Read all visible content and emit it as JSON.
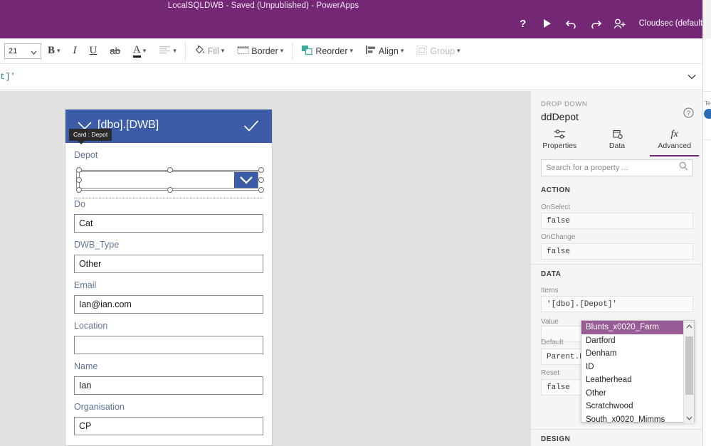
{
  "topbar": {
    "title": "LocalSQLDWB - Saved (Unpublished) - PowerApps",
    "help_icon": "help-icon",
    "play_icon": "play-icon",
    "undo_icon": "undo-icon",
    "redo_icon": "redo-icon",
    "share_icon": "add-user-icon",
    "user": "Cloudsec (default)"
  },
  "toolbar": {
    "font_size": "21",
    "bold": "B",
    "italic": "I",
    "underline": "U",
    "strikethrough": "ab",
    "font_color": "A",
    "align": "",
    "fill": "Fill",
    "border": "Border",
    "reorder": "Reorder",
    "align_label": "Align",
    "group": "Group"
  },
  "formula_bar": {
    "value": "t]'"
  },
  "canvas": {
    "form_header_title": "[dbo].[DWB]",
    "tooltip": "Card : Depot",
    "fields": [
      {
        "label": "Depot",
        "value": "",
        "type": "dropdown"
      },
      {
        "label": "Do",
        "value": "Cat",
        "type": "text"
      },
      {
        "label": "DWB_Type",
        "value": "Other",
        "type": "text"
      },
      {
        "label": "Email",
        "value": "Ian@ian.com",
        "type": "text"
      },
      {
        "label": "Location",
        "value": "",
        "type": "text"
      },
      {
        "label": "Name",
        "value": "Ian",
        "type": "text"
      },
      {
        "label": "Organisation",
        "value": "CP",
        "type": "text"
      }
    ]
  },
  "properties_panel": {
    "kicker": "DROP DOWN",
    "control_name": "ddDepot",
    "tabs": [
      {
        "label": "Properties",
        "icon": "sliders-icon",
        "active": false
      },
      {
        "label": "Data",
        "icon": "database-icon",
        "active": false
      },
      {
        "label": "Advanced",
        "icon": "fx-icon",
        "active": true
      }
    ],
    "search_placeholder": "Search for a property ...",
    "sections": [
      {
        "title": "ACTION",
        "props": [
          {
            "label": "OnSelect",
            "value": "false"
          },
          {
            "label": "OnChange",
            "value": "false"
          }
        ]
      },
      {
        "title": "DATA",
        "props": [
          {
            "label": "Items",
            "value": "'[dbo].[Depot]'"
          },
          {
            "label": "Value",
            "value": ""
          },
          {
            "label": "Default",
            "value": "Parent.Def"
          },
          {
            "label": "Reset",
            "value": "false"
          }
        ]
      },
      {
        "title": "DESIGN",
        "props": []
      }
    ]
  },
  "dropdown_flyout": {
    "options": [
      "Blunts_x0020_Farm",
      "Dartford",
      "Denham",
      "ID",
      "Leatherhead",
      "Other",
      "Scratchwood",
      "South_x0020_Mimms"
    ],
    "selected": "Blunts_x0020_Farm"
  },
  "sliver": {
    "label": "Te"
  },
  "colors": {
    "brand_purple": "#742774",
    "form_blue": "#3c5ca8",
    "highlight": "#9a5c96",
    "canvas_bg": "#e1e1e1",
    "panel_bg": "#f5f5f5",
    "formula_text": "#2e7d78",
    "field_label": "#5f7599"
  }
}
